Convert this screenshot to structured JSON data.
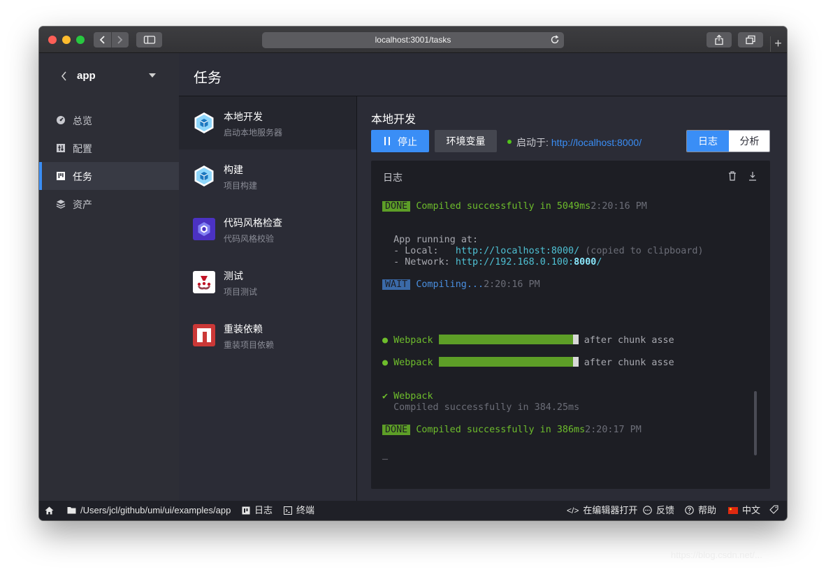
{
  "browser": {
    "url": "localhost:3001/tasks"
  },
  "project": {
    "name": "app"
  },
  "sidebar": {
    "items": [
      {
        "label": "总览",
        "icon": "dashboard-icon"
      },
      {
        "label": "配置",
        "icon": "config-icon"
      },
      {
        "label": "任务",
        "icon": "tasks-icon",
        "active": true
      },
      {
        "label": "资产",
        "icon": "assets-icon"
      }
    ]
  },
  "page": {
    "title": "任务"
  },
  "tasks": [
    {
      "name": "本地开发",
      "desc": "启动本地服务器",
      "icon": "webpack-icon",
      "active": true
    },
    {
      "name": "构建",
      "desc": "项目构建",
      "icon": "webpack-icon"
    },
    {
      "name": "代码风格检查",
      "desc": "代码风格校验",
      "icon": "eslint-icon"
    },
    {
      "name": "测试",
      "desc": "项目测试",
      "icon": "jest-icon"
    },
    {
      "name": "重装依赖",
      "desc": "重装项目依赖",
      "icon": "npm-icon"
    }
  ],
  "detail": {
    "title": "本地开发",
    "stop_label": "停止",
    "env_label": "环境变量",
    "status_prefix": "启动于:",
    "status_url": "http://localhost:8000/",
    "tabs": [
      "日志",
      "分析"
    ],
    "active_tab": "日志"
  },
  "console": {
    "title": "日志",
    "lines": {
      "done1_badge": "DONE",
      "done1_text": "Compiled successfully in 5049ms",
      "done1_time": "2:20:16 PM",
      "running_header": "App running at:",
      "local_label": "- Local:   ",
      "local_url": "http://localhost:8000/",
      "local_note": " (copied to clipboard)",
      "network_label": "- Network: ",
      "network_url_base": "http://192.168.0.100:",
      "network_url_port": "8000",
      "network_url_tail": "/",
      "wait_badge": "WAIT",
      "wait_text": "Compiling...",
      "wait_time": "2:20:16 PM",
      "progress_label": "Webpack",
      "progress1_text": "after chunk asse",
      "progress2_text": "after chunk asse",
      "webpack_done": "Webpack",
      "webpack_done_text": "Compiled successfully in 384.25ms",
      "done2_badge": "DONE",
      "done2_text": "Compiled successfully in 386ms",
      "done2_time": "2:20:17 PM",
      "cursor": "_"
    },
    "progress": [
      1.0,
      1.0
    ]
  },
  "statusbar": {
    "path": "/Users/jcl/github/umi/ui/examples/app",
    "log": "日志",
    "terminal": "终端",
    "open_editor": "在编辑器打开",
    "feedback": "反馈",
    "help": "帮助",
    "language": "中文"
  },
  "watermark": "https://blog.csdn.net/..."
}
